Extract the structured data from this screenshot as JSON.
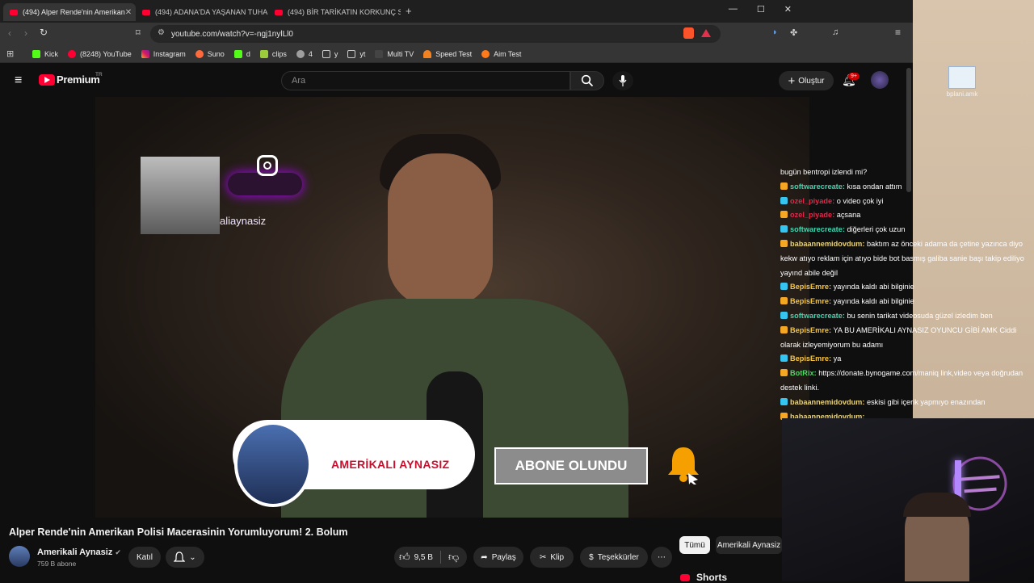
{
  "browser": {
    "tabs": [
      {
        "title": "(494) Alper Rende'nin Amerikan",
        "active": true
      },
      {
        "title": "(494) ADANA'DA YAŞANAN TUHAF C",
        "active": false
      },
      {
        "title": "(494) BİR TARİKATIN KORKUNÇ SON",
        "active": false
      }
    ],
    "url": "youtube.com/watch?v=-ngj1nylLl0",
    "bookmarks": [
      "Kick",
      "(8248) YouTube",
      "Instagram",
      "Suno",
      "d",
      "clips",
      "4",
      "y",
      "yt",
      "Multi TV",
      "Speed Test",
      "Aim Test"
    ]
  },
  "desktop": {
    "icon_label": "bplani.amk"
  },
  "youtube": {
    "logo_text": "Premium",
    "logo_region": "TR",
    "search_placeholder": "Ara",
    "create_label": "Oluştur",
    "notification_count": "9+"
  },
  "video": {
    "instagram_handle": "aliaynasiz",
    "banner_channel": "AMERİKALI AYNASIZ",
    "banner_button": "ABONE OLUNDU",
    "title": "Alper Rende'nin Amerikan Polisi Macerasinin Yorumluyorum! 2. Bolum",
    "channel": "Amerikali Aynasiz",
    "subscribers": "759 B abone",
    "join_label": "Katıl",
    "likes": "9,5 B",
    "share_label": "Paylaş",
    "clip_label": "Klip",
    "thanks_label": "Teşekkürler"
  },
  "sidebar": {
    "chips": [
      "Tümü",
      "Amerikali Aynasiz"
    ],
    "shorts_label": "Shorts"
  },
  "chat": [
    {
      "user": "",
      "text": "bugün bentropi izlendi mi?",
      "color": "#ffffff"
    },
    {
      "user": "softwarecreate:",
      "text": "kısa ondan attım",
      "color": "#3dd6b0"
    },
    {
      "user": "ozel_piyade:",
      "text": "o video çok iyi",
      "color": "#e0294a"
    },
    {
      "user": "ozel_piyade:",
      "text": "açsana",
      "color": "#e0294a"
    },
    {
      "user": "softwarecreate:",
      "text": "diğerleri çok uzun",
      "color": "#3dd6b0"
    },
    {
      "user": "babaannemidovdum:",
      "text": "baktım az önceki adama da çetine yazınca diyo kekw atıyo reklam için atıyo bide bot basmış galiba sanie başı takip ediliyo yayınd abile değil",
      "color": "#e8d27a",
      "wrap": true
    },
    {
      "user": "BepisEmre:",
      "text": "yayında kaldı abi bilginie",
      "color": "#f5c542"
    },
    {
      "user": "BepisEmre:",
      "text": "yayında kaldı abi bilginie",
      "color": "#f5c542"
    },
    {
      "user": "softwarecreate:",
      "text": "bu senin tarikat videosuda güzel izledim ben",
      "color": "#3dd6b0"
    },
    {
      "user": "BepisEmre:",
      "text": "YA BU AMERİKALI AYNASIZ OYUNCU GİBİ AMK Ciddi olarak izleyemiyorum bu adamı",
      "color": "#f5c542",
      "wrap": true
    },
    {
      "user": "BepisEmre:",
      "text": "ya",
      "color": "#f5c542"
    },
    {
      "user": "BotRix:",
      "text": "https://donate.bynogame.com/maniq link,video veya doğrudan destek linki.",
      "color": "#4cd964",
      "wrap": true
    },
    {
      "user": "babaannemidovdum:",
      "text": "eskisi gibi içerik yapmıyo enazından",
      "color": "#e8d27a"
    },
    {
      "user": "babaannemidovdum:",
      "text": "",
      "color": "#e8d27a"
    }
  ],
  "colors": {
    "youtube_red": "#ff0033",
    "background": "#0f0f0f",
    "banner_red": "#c8102e"
  }
}
